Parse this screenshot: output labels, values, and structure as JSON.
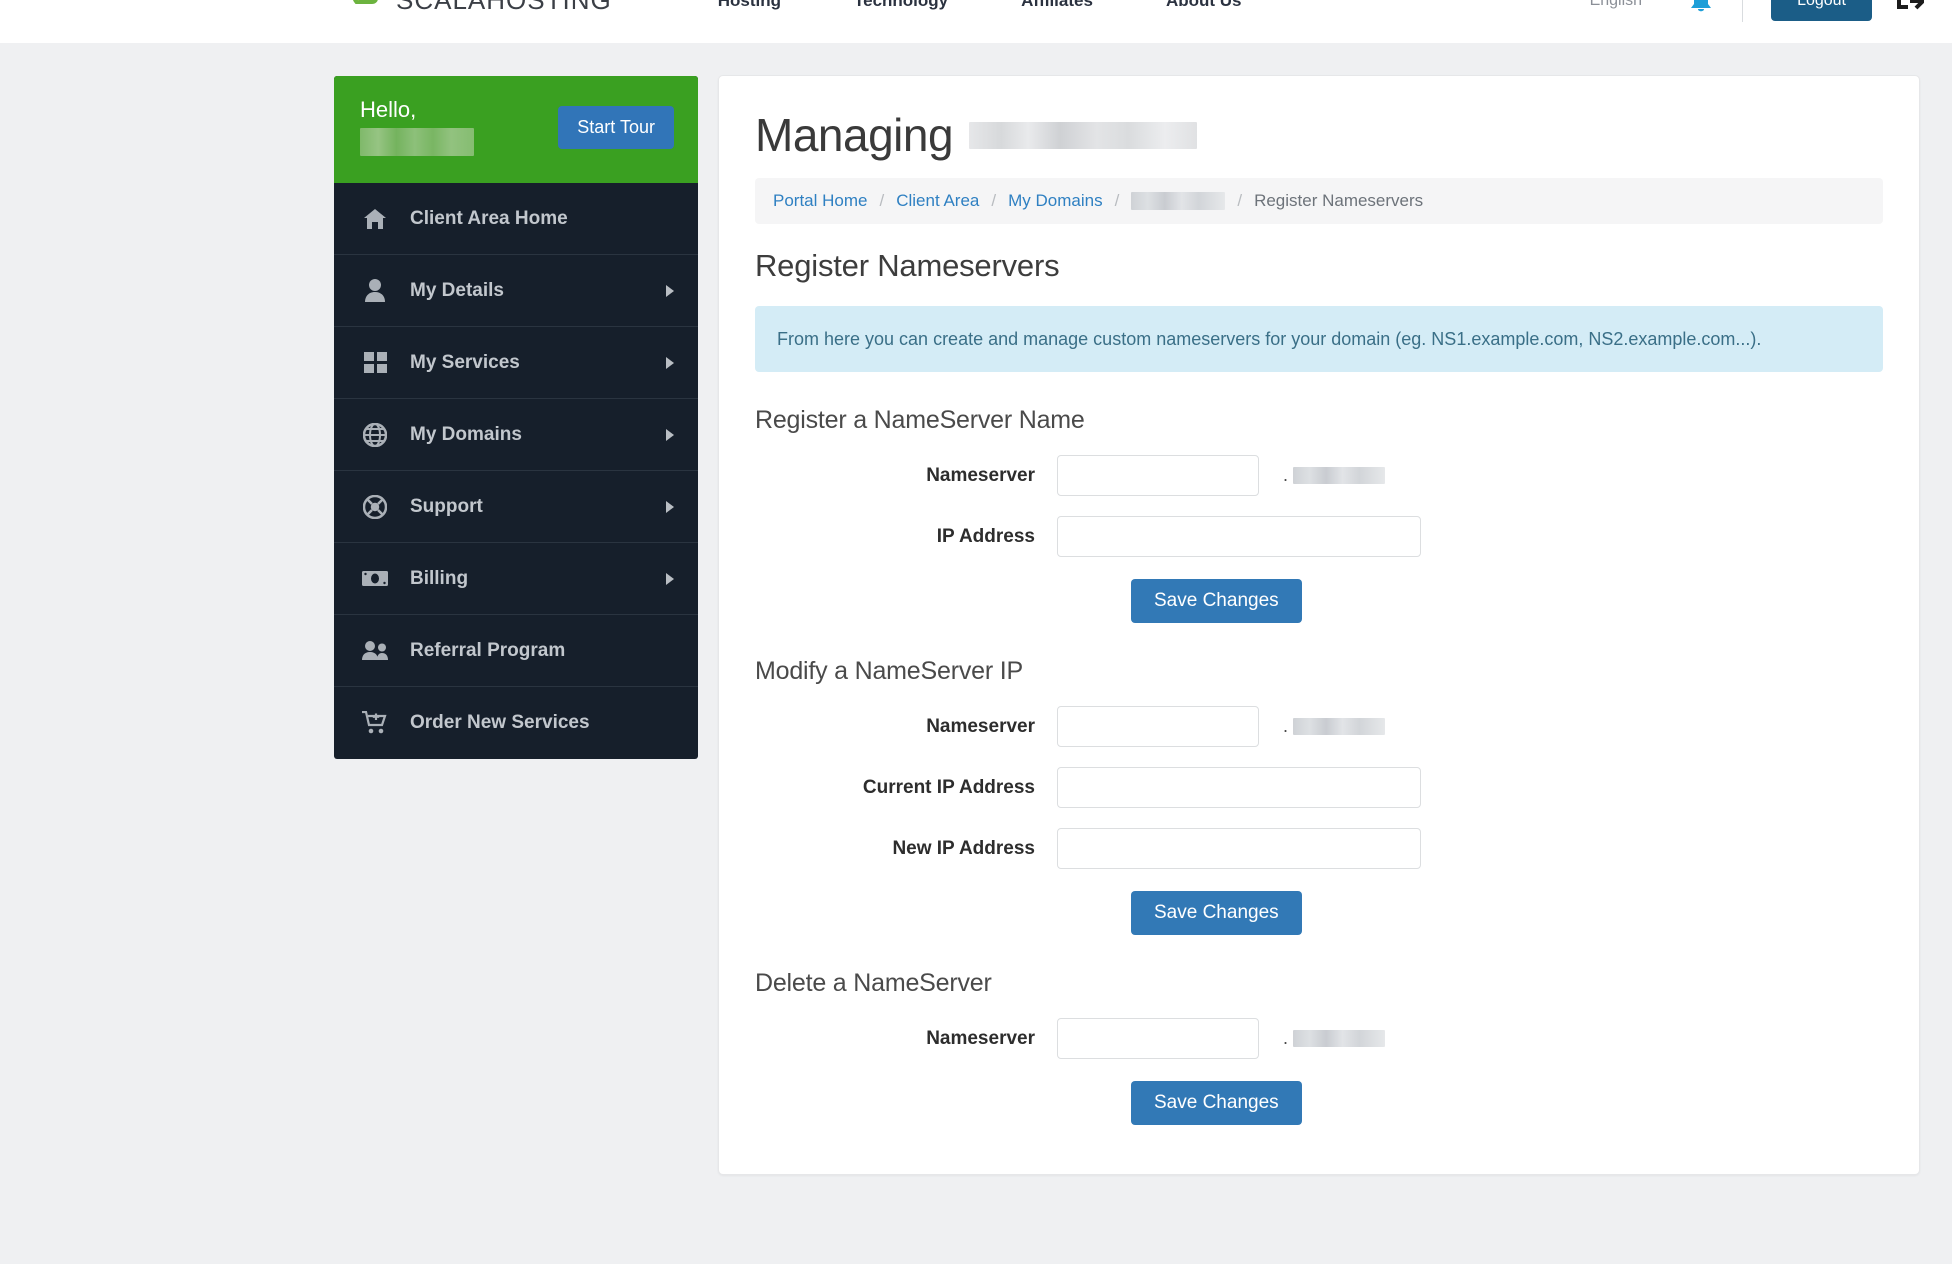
{
  "header": {
    "brand_name": "SCALAHOSTING",
    "nav": [
      {
        "label": "Hosting"
      },
      {
        "label": "Technology"
      },
      {
        "label": "Affiliates"
      },
      {
        "label": "About Us"
      }
    ],
    "language": "English",
    "logout_label": "Logout",
    "notification_icon": "bell-icon",
    "session_icon": "session-switch-icon",
    "brand_icon": "scalahosting-logo-icon"
  },
  "sidebar": {
    "greeting": "Hello,",
    "username_redacted": "",
    "start_tour_label": "Start Tour",
    "items": [
      {
        "label": "Client Area Home",
        "icon": "home-icon",
        "has_caret": false
      },
      {
        "label": "My Details",
        "icon": "user-icon",
        "has_caret": true
      },
      {
        "label": "My Services",
        "icon": "grid-icon",
        "has_caret": true
      },
      {
        "label": "My Domains",
        "icon": "globe-icon",
        "has_caret": true
      },
      {
        "label": "Support",
        "icon": "lifering-icon",
        "has_caret": true
      },
      {
        "label": "Billing",
        "icon": "money-icon",
        "has_caret": true
      },
      {
        "label": "Referral Program",
        "icon": "users-icon",
        "has_caret": false
      },
      {
        "label": "Order New Services",
        "icon": "cart-plus-icon",
        "has_caret": false
      }
    ]
  },
  "main": {
    "page_title_prefix": "Managing",
    "page_title_domain_redacted": "",
    "breadcrumb": {
      "items": [
        {
          "label": "Portal Home",
          "link": true
        },
        {
          "label": "Client Area",
          "link": true
        },
        {
          "label": "My Domains",
          "link": true
        }
      ],
      "redacted_item": "",
      "current": "Register Nameservers",
      "separator": "/"
    },
    "section_title": "Register Nameservers",
    "info_text": "From here you can create and manage custom nameservers for your domain (eg. NS1.example.com, NS2.example.com...).",
    "groups": [
      {
        "title": "Register a NameServer Name",
        "fields": [
          {
            "label": "Nameserver",
            "value": "",
            "size": "short",
            "suffix_dot": ".",
            "suffix_redacted": ""
          },
          {
            "label": "IP Address",
            "value": "",
            "size": "long",
            "suffix_dot": "",
            "suffix_redacted": null
          }
        ],
        "submit_label": "Save Changes"
      },
      {
        "title": "Modify a NameServer IP",
        "fields": [
          {
            "label": "Nameserver",
            "value": "",
            "size": "short",
            "suffix_dot": ".",
            "suffix_redacted": ""
          },
          {
            "label": "Current IP Address",
            "value": "",
            "size": "long",
            "suffix_dot": "",
            "suffix_redacted": null
          },
          {
            "label": "New IP Address",
            "value": "",
            "size": "long",
            "suffix_dot": "",
            "suffix_redacted": null
          }
        ],
        "submit_label": "Save Changes"
      },
      {
        "title": "Delete a NameServer",
        "fields": [
          {
            "label": "Nameserver",
            "value": "",
            "size": "short",
            "suffix_dot": ".",
            "suffix_redacted": ""
          }
        ],
        "submit_label": "Save Changes"
      }
    ]
  },
  "colors": {
    "accent_blue": "#3279b6",
    "sidebar_dark": "#161f2b",
    "greeting_green": "#3aa021",
    "info_blue": "#d4ecf6",
    "logout_blue": "#1b5d87",
    "page_bg": "#eff0f2"
  }
}
